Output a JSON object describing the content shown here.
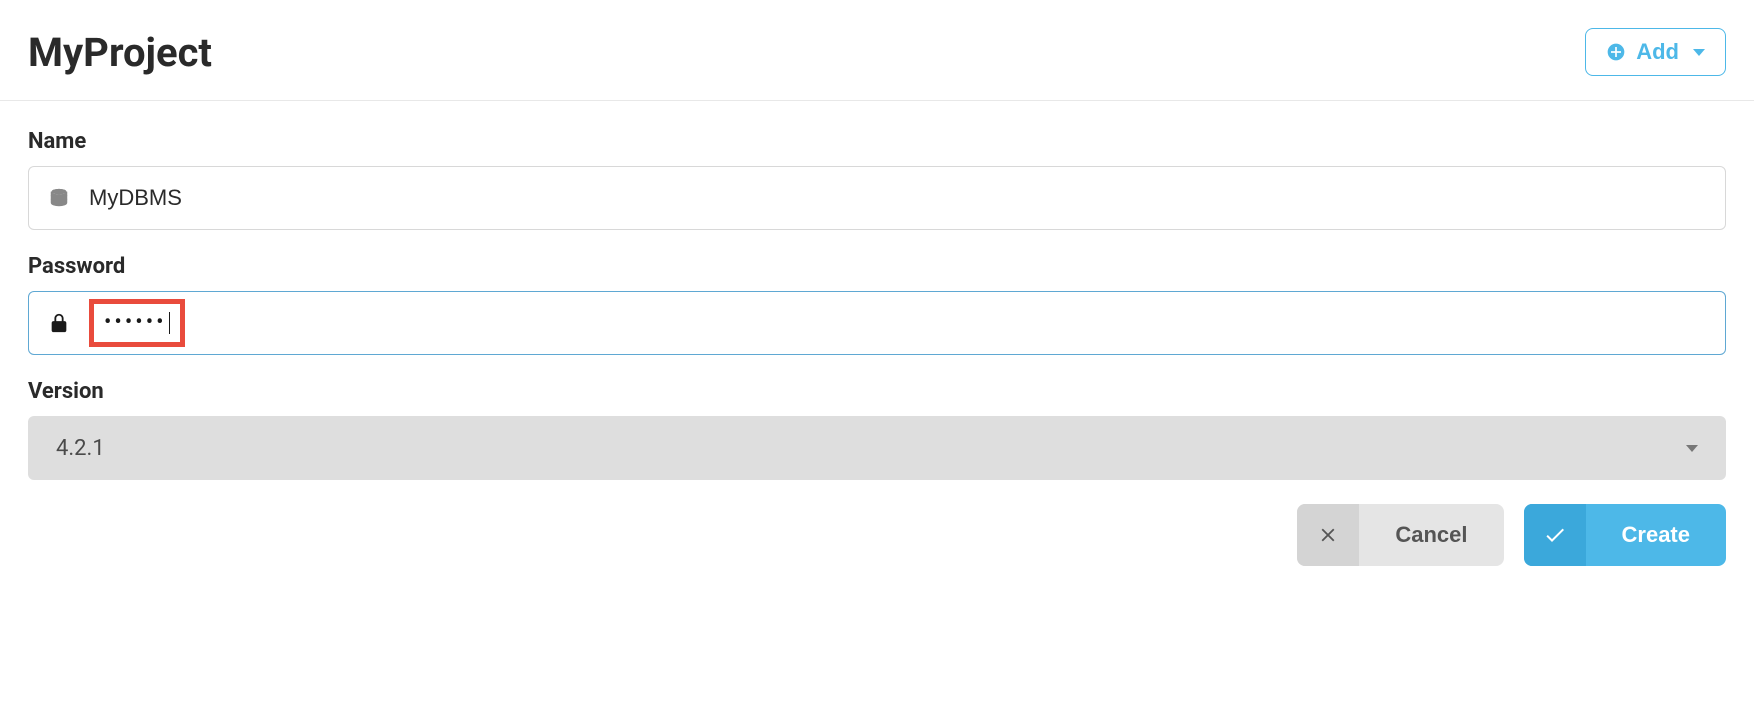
{
  "header": {
    "title": "MyProject",
    "add_label": "Add"
  },
  "form": {
    "name_label": "Name",
    "name_value": "MyDBMS",
    "password_label": "Password",
    "password_value": "••••••",
    "version_label": "Version",
    "version_value": "4.2.1"
  },
  "actions": {
    "cancel_label": "Cancel",
    "create_label": "Create"
  }
}
